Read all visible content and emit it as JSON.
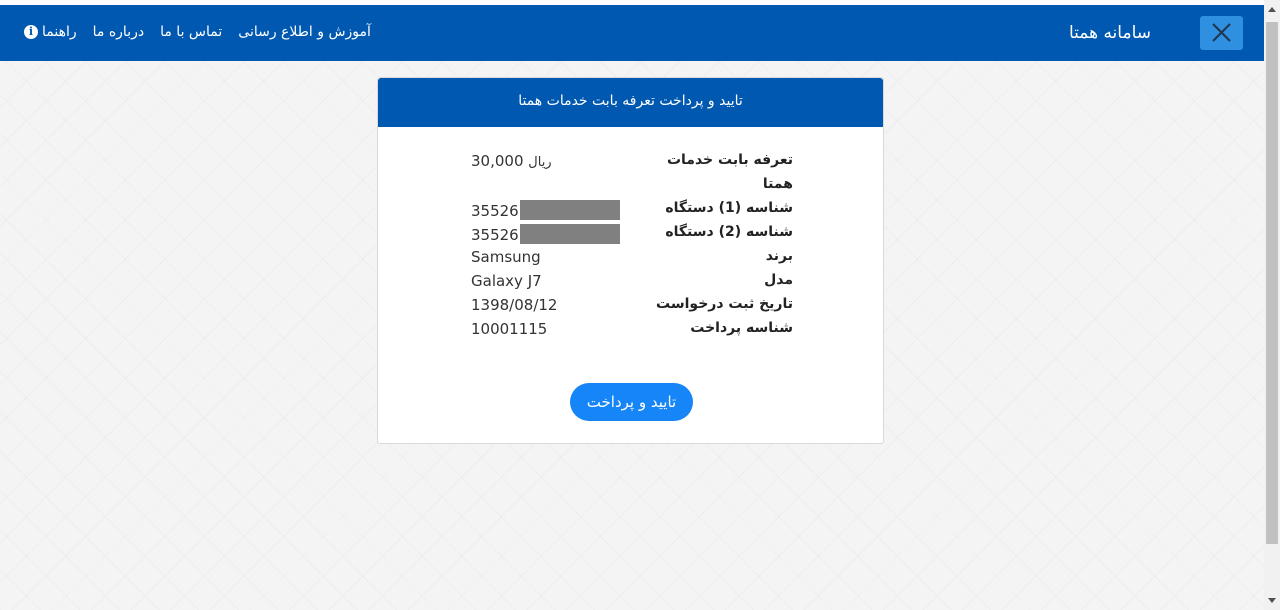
{
  "navbar": {
    "brand": "سامانه همتا",
    "links": [
      "آموزش و اطلاع رسانی",
      "تماس با ما",
      "درباره ما",
      "راهنما"
    ],
    "help_icon": "i",
    "background": "#0058b0"
  },
  "card": {
    "title": "تایید و پرداخت تعرفه بابت خدمات همتا",
    "fields": [
      {
        "label_line1": "تعرفه بابت خدمات",
        "label_line2": "همتا",
        "value": "30,000",
        "unit": "ریال"
      },
      {
        "label": "شناسه (1) دستگاه",
        "value": "35526",
        "masked": true
      },
      {
        "label": "شناسه (2) دستگاه",
        "value": "35526",
        "masked": true
      },
      {
        "label": "برند",
        "value": "Samsung"
      },
      {
        "label": "مدل",
        "value": "Galaxy J7"
      },
      {
        "label": "تاریخ ثبت درخواست",
        "value": "1398/08/12"
      },
      {
        "label": "شناسه پرداخت",
        "value": "10001115"
      }
    ],
    "button_label": "تایید و پرداخت",
    "button_color": "#1685f8"
  }
}
